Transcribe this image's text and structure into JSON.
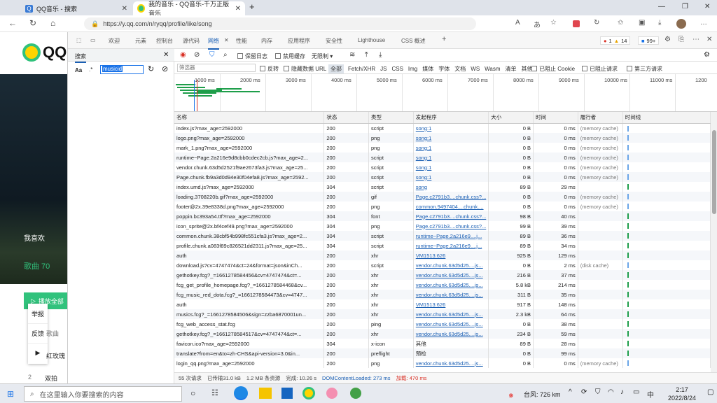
{
  "tabs": [
    {
      "title": "QQ音乐 - 搜索",
      "active": false
    },
    {
      "title": "我的音乐 - QQ音乐-千万正版音乐",
      "active": true
    }
  ],
  "address": {
    "url": "https://y.qq.com/n/ryqq/profile/like/song"
  },
  "page": {
    "logo": "QQ",
    "my_like": "我喜欢",
    "songs": "歌曲 70",
    "play_all": "播放全部",
    "report": "举报",
    "feedback": "反馈",
    "song_head": "歌曲",
    "song_name": "红玫瑰",
    "row_num": "2",
    "row_name": "双拍"
  },
  "devtools": {
    "tabs": [
      "欢迎",
      "元素",
      "控制台",
      "源代码",
      "网络",
      "性能",
      "内存",
      "应用程序",
      "安全性",
      "Lighthouse",
      "CSS 概述"
    ],
    "badges": {
      "errors": "1",
      "warnings": "14",
      "info": "99+"
    },
    "search": {
      "title": "搜索",
      "query": "musicid",
      "case_label": "Aa",
      "regex_label": ".*"
    },
    "toolbar": {
      "preserve_log": "保留日志",
      "disable_cache": "禁用缓存",
      "throttle": "无限制"
    },
    "filter": {
      "placeholder": "筛选器",
      "invert": "反转",
      "hide_data": "隐藏数据 URL",
      "all": "全部",
      "types": [
        "Fetch/XHR",
        "JS",
        "CSS",
        "Img",
        "媒体",
        "字体",
        "文档",
        "WS",
        "Wasm",
        "清单",
        "其他"
      ],
      "blocked_cookies": "已阻止 Cookie",
      "blocked_requests": "已阻止请求",
      "third_party": "第三方请求"
    },
    "ticks": [
      "1000 ms",
      "2000 ms",
      "3000 ms",
      "4000 ms",
      "5000 ms",
      "6000 ms",
      "7000 ms",
      "8000 ms",
      "9000 ms",
      "10000 ms",
      "11000 ms",
      "1200"
    ],
    "headers": [
      "名称",
      "状态",
      "类型",
      "发起程序",
      "大小",
      "时间",
      "履行者",
      "时间线"
    ],
    "rows": [
      [
        "index.js?max_age=2592000",
        "200",
        "script",
        "song:1",
        "0 B",
        "0 ms",
        "(memory cache)"
      ],
      [
        "logo.png?max_age=2592000",
        "200",
        "png",
        "song:1",
        "0 B",
        "0 ms",
        "(memory cache)"
      ],
      [
        "mark_1.png?max_age=2592000",
        "200",
        "png",
        "song:1",
        "0 B",
        "0 ms",
        "(memory cache)"
      ],
      [
        "runtime~Page.2a216e9d8cbb0cdec2cb.js?max_age=2...",
        "200",
        "script",
        "song:1",
        "0 B",
        "0 ms",
        "(memory cache)"
      ],
      [
        "vendor.chunk.63d5d2521f9ae2673fa3.js?max_age=25...",
        "200",
        "script",
        "song:1",
        "0 B",
        "0 ms",
        "(memory cache)"
      ],
      [
        "Page.chunk.fb9a3d0d94e30f04efa8.js?max_age=2592...",
        "200",
        "script",
        "song:1",
        "0 B",
        "0 ms",
        "(memory cache)"
      ],
      [
        "index.umd.js?max_age=2592000",
        "304",
        "script",
        "song",
        "89 B",
        "29 ms",
        ""
      ],
      [
        "loading.3708220b.gif?max_age=2592000",
        "200",
        "gif",
        "Page.c2791b3....chunk.css?...",
        "0 B",
        "0 ms",
        "(memory cache)"
      ],
      [
        "footer@2x.39e8338d.png?max_age=2592000",
        "200",
        "png",
        "common.9497404....chunk....",
        "0 B",
        "0 ms",
        "(memory cache)"
      ],
      [
        "poppin.bc393a54.ttf?max_age=2592000",
        "304",
        "font",
        "Page.c2791b3....chunk.css?...",
        "98 B",
        "40 ms",
        ""
      ],
      [
        "icon_sprite@2x.bf4cef49.png?max_age=2592000",
        "304",
        "png",
        "Page.c2791b3....chunk.css?...",
        "99 B",
        "39 ms",
        ""
      ],
      [
        "common.chunk.38cbf54b998fc551cfa3.js?max_age=2...",
        "304",
        "script",
        "runtime~Page.2a216e9....j...",
        "89 B",
        "36 ms",
        ""
      ],
      [
        "profile.chunk.a083f89c826521dd2311.js?max_age=25...",
        "304",
        "script",
        "runtime~Page.2a216e9....j...",
        "89 B",
        "34 ms",
        ""
      ],
      [
        "auth",
        "200",
        "xhr",
        "VM1513:626",
        "925 B",
        "129 ms",
        ""
      ],
      [
        "download.js?cv=4747474&ct=24&format=json&inCh...",
        "200",
        "script",
        "vendor.chunk.63d5d25....js...",
        "0 B",
        "2 ms",
        "(disk cache)"
      ],
      [
        "gethotkey.fcg?_=1661278584456&cv=4747474&ct=...",
        "200",
        "xhr",
        "vendor.chunk.63d5d25....js...",
        "216 B",
        "37 ms",
        ""
      ],
      [
        "fcg_get_profile_homepage.fcg?_=1661278584468&cv...",
        "200",
        "xhr",
        "vendor.chunk.63d5d25....js...",
        "5.8 kB",
        "214 ms",
        ""
      ],
      [
        "fcg_music_red_dota.fcg?_=1661278584473&cv=4747...",
        "200",
        "xhr",
        "vendor.chunk.63d5d25....js...",
        "311 B",
        "35 ms",
        ""
      ],
      [
        "auth",
        "200",
        "xhr",
        "VM1513:626",
        "917 B",
        "148 ms",
        ""
      ],
      [
        "musics.fcg?_=1661278584506&sign=zzba6870001un...",
        "200",
        "xhr",
        "vendor.chunk.63d5d25....js...",
        "2.3 kB",
        "64 ms",
        ""
      ],
      [
        "fcg_web_access_stat.fcg",
        "200",
        "ping",
        "vendor.chunk.63d5d25....js...",
        "0 B",
        "38 ms",
        ""
      ],
      [
        "gethotkey.fcg?_=1661278584517&cv=4747474&ct=...",
        "200",
        "xhr",
        "vendor.chunk.63d5d25....js...",
        "234 B",
        "59 ms",
        ""
      ],
      [
        "favicon.ico?max_age=2592000",
        "304",
        "x-icon",
        "其他",
        "89 B",
        "28 ms",
        ""
      ],
      [
        "translate?from=en&to=zh-CHS&api-version=3.0&in...",
        "200",
        "preflight",
        "预检",
        "0 B",
        "99 ms",
        ""
      ],
      [
        "login_qq.png?max_age=2592000",
        "200",
        "png",
        "vendor.chunk.63d5d25....js...",
        "0 B",
        "0 ms",
        "(memory cache)"
      ]
    ],
    "status": {
      "requests": "55 次请求",
      "transferred": "已传输31.0 kB",
      "resources": "1.2 MB 条资源",
      "finish": "完成: 10.26 s",
      "dcl": "DOMContentLoaded: 273 ms",
      "load": "加载: 470 ms"
    }
  },
  "taskbar": {
    "search_placeholder": "在这里输入你要搜索的内容",
    "weather": "台风: 726 km",
    "ime": "中",
    "time": "2:17",
    "date": "2022/8/24"
  }
}
